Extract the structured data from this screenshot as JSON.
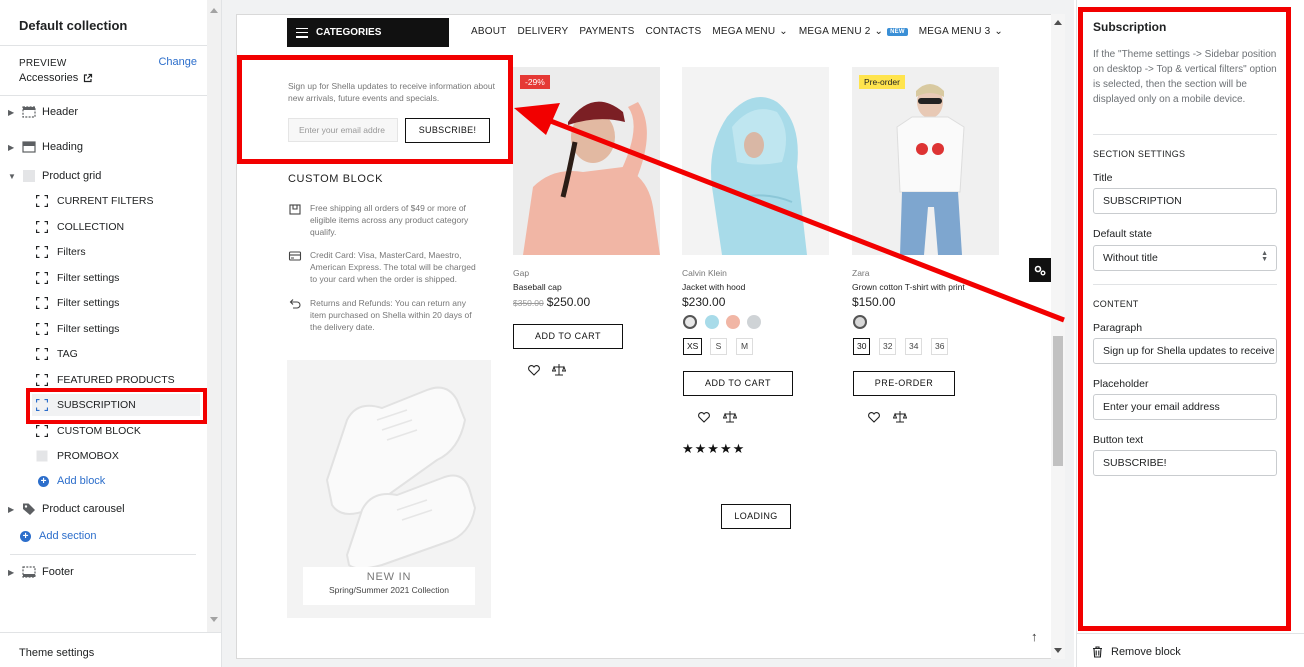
{
  "sidebar": {
    "title": "Default collection",
    "preview_label": "PREVIEW",
    "preview_value": "Accessories",
    "change_label": "Change",
    "sections": [
      {
        "label": "Header",
        "icon": "header-section-icon"
      },
      {
        "label": "Heading",
        "icon": "heading-section-icon"
      },
      {
        "label": "Product grid",
        "icon": "product-grid-section-icon"
      }
    ],
    "blocks": [
      "CURRENT FILTERS",
      "COLLECTION",
      "Filters",
      "Filter settings",
      "Filter settings",
      "Filter settings",
      "TAG",
      "FEATURED PRODUCTS",
      "SUBSCRIPTION",
      "CUSTOM BLOCK",
      "PROMOBOX"
    ],
    "add_block": "Add block",
    "product_carousel": "Product carousel",
    "add_section": "Add section",
    "footer": "Footer",
    "theme_settings": "Theme settings"
  },
  "store": {
    "categories": "CATEGORIES",
    "nav": [
      {
        "label": "ABOUT"
      },
      {
        "label": "DELIVERY"
      },
      {
        "label": "PAYMENTS"
      },
      {
        "label": "CONTACTS"
      },
      {
        "label": "MEGA MENU"
      },
      {
        "label": "MEGA MENU 2",
        "badge": "NEW"
      },
      {
        "label": "MEGA MENU 3"
      }
    ],
    "subscribe": {
      "text": "Sign up for Shella updates to receive information about new arrivals, future events and specials.",
      "placeholder": "Enter your email addre",
      "button": "SUBSCRIBE!"
    },
    "custom_block": {
      "title": "CUSTOM BLOCK",
      "items": [
        "Free shipping all orders of $49 or more of eligible items across any product category qualify.",
        "Credit Card: Visa, MasterCard, Maestro, American Express. The total will be charged to your card when the order is shipped.",
        "Returns and Refunds: You can return any item purchased on Shella within 20 days of the delivery date."
      ]
    },
    "promo": {
      "line1": "NEW IN",
      "line2": "Spring/Summer 2021 Collection"
    },
    "products": [
      {
        "tag": "-29%",
        "brand": "Gap",
        "name": "Baseball cap",
        "old_price": "$350.00",
        "price": "$250.00",
        "button": "ADD TO CART"
      },
      {
        "brand": "Calvin Klein",
        "name": "Jacket with hood",
        "price": "$230.00",
        "sizes": [
          "XS",
          "S",
          "M"
        ],
        "button": "ADD TO CART",
        "rating_stars": "★★★★★"
      },
      {
        "tag": "Pre-order",
        "brand": "Zara",
        "name": "Grown cotton T-shirt with print",
        "price": "$150.00",
        "sizes": [
          "30",
          "32",
          "34",
          "36"
        ],
        "button": "PRE-ORDER"
      }
    ],
    "loading": "LOADING",
    "colors": {
      "sale_tag": "#e53935",
      "preorder_tag": "#ffe44d",
      "pink_sweater": "#f1b6a5",
      "blue_jacket": "#a8dbe9"
    }
  },
  "panel": {
    "title": "Subscription",
    "description": "If the \"Theme settings -> Sidebar position on desktop -> Top & vertical filters\" option is selected, then the section will be displayed only on a mobile device.",
    "section_settings": "SECTION SETTINGS",
    "title_label": "Title",
    "title_value": "SUBSCRIPTION",
    "default_state_label": "Default state",
    "default_state_value": "Without title",
    "content": "CONTENT",
    "paragraph_label": "Paragraph",
    "paragraph_value": "Sign up for Shella updates to receive",
    "placeholder_label": "Placeholder",
    "placeholder_value": "Enter your email address",
    "button_text_label": "Button text",
    "button_text_value": "SUBSCRIBE!",
    "remove": "Remove block"
  },
  "annotation_color": "#f20000"
}
